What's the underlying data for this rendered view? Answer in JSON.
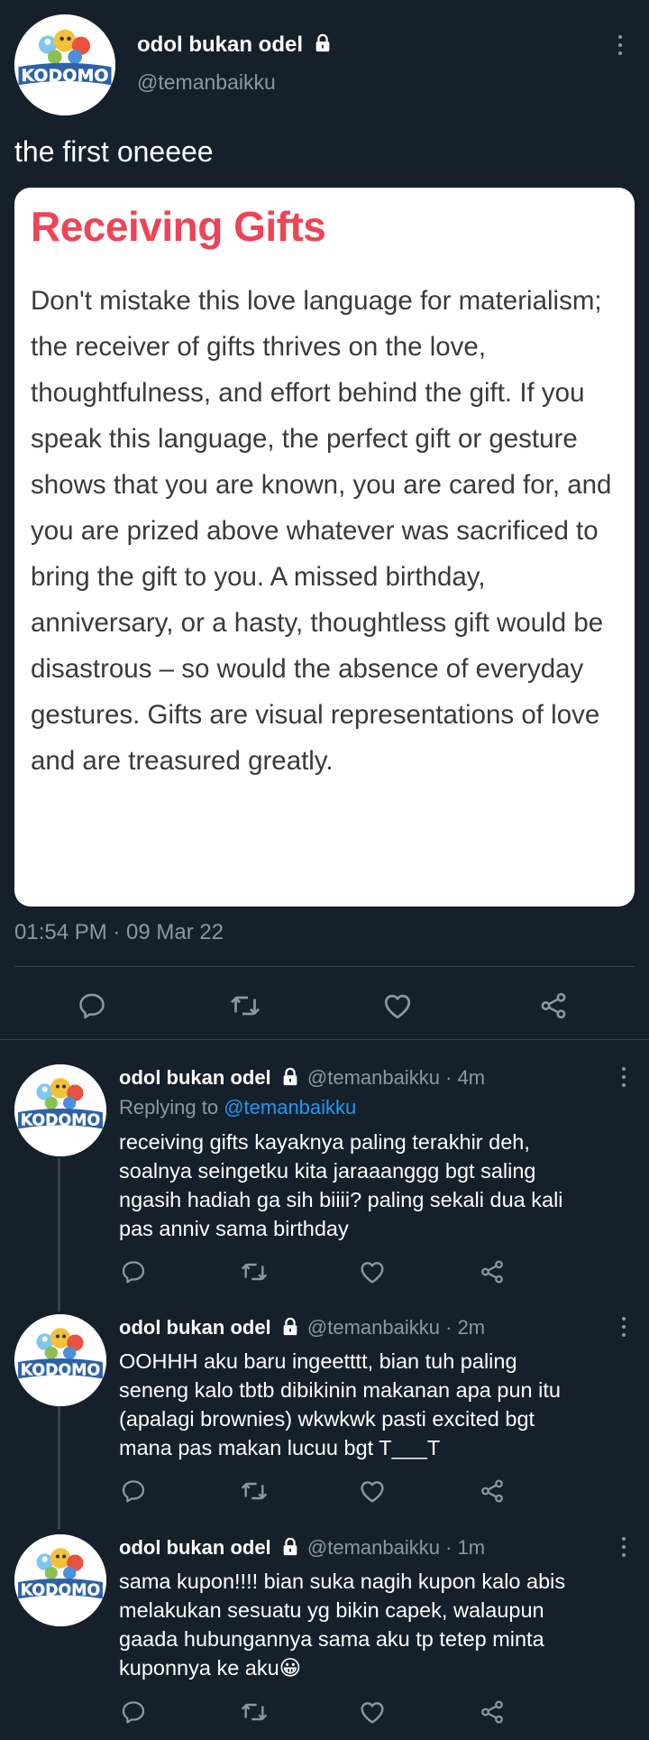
{
  "tweet": {
    "author_name": "odol bukan odel",
    "author_handle": "@temanbaikku",
    "avatar_brand": "KODOMO",
    "text": "the first oneeee",
    "timestamp": "01:54 PM · 09 Mar 22",
    "image": {
      "title": "Receiving Gifts",
      "body": "Don't mistake this love language for materialism; the receiver of gifts thrives on the love, thoughtfulness, and effort behind the gift. If you speak this language, the perfect gift or gesture shows that you are known, you are cared for, and you are prized above whatever was sacrificed to bring the gift to you. A missed birthday, anniversary, or a hasty, thoughtless gift would be disastrous – so would the absence of everyday gestures. Gifts are visual representations of love and are treasured greatly."
    },
    "actions": [
      "reply-icon",
      "retweet-icon",
      "like-icon",
      "share-icon"
    ]
  },
  "replies": [
    {
      "name": "odol bukan odel",
      "handle": "@temanbaikku",
      "time": "· 4m",
      "replying_to_label": "Replying to",
      "replying_to_handle": "@temanbaikku",
      "lines": [
        "receiving gifts kayaknya paling terakhir deh,",
        "soalnya seingetku kita jaraaanggg bgt saling",
        "ngasih hadiah ga sih biiii? paling sekali dua kali",
        "pas anniv sama birthday"
      ]
    },
    {
      "name": "odol bukan odel",
      "handle": "@temanbaikku",
      "time": "· 2m",
      "lines": [
        "OOHHH aku baru ingeetttt, bian tuh paling",
        "seneng kalo tbtb dibikinin makanan apa pun itu",
        "(apalagi brownies) wkwkwk pasti excited bgt",
        "mana pas makan lucuu bgt T___T"
      ]
    },
    {
      "name": "odol bukan odel",
      "handle": "@temanbaikku",
      "time": "· 1m",
      "lines": [
        "sama kupon!!!! bian suka nagih kupon kalo abis",
        "melakukan sesuatu yg bikin capek, walaupun",
        "gaada hubungannya sama aku tp tetep minta",
        "kuponnya ke aku😀"
      ]
    }
  ],
  "colors": {
    "background": "#15202b",
    "text": "#ffffff",
    "muted": "#8899a6",
    "link": "#1d9bf0",
    "card_title": "#ee4456"
  }
}
